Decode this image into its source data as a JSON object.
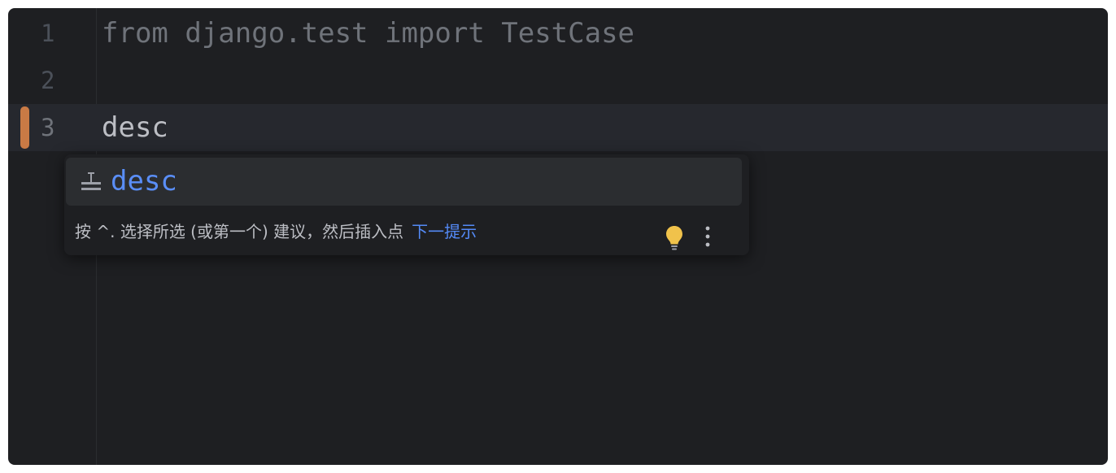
{
  "editor": {
    "lines": [
      {
        "number": "1",
        "code": "from django.test import TestCase"
      },
      {
        "number": "2",
        "code": ""
      },
      {
        "number": "3",
        "code": "desc"
      }
    ]
  },
  "completion_popup": {
    "item": {
      "icon": "live-template-icon",
      "label": "desc"
    },
    "hint_text": "按 ^. 选择所选 (或第一个) 建议，然后插入点",
    "hint_link": "下一提示",
    "bulb_icon": "lightbulb-icon",
    "more_icon": "more-vertical-icon"
  },
  "colors": {
    "background": "#1e1f22",
    "current_line": "#26282e",
    "change_marker": "#c97a45",
    "accent_blue": "#5a8ef7",
    "bulb": "#f0c24b"
  }
}
